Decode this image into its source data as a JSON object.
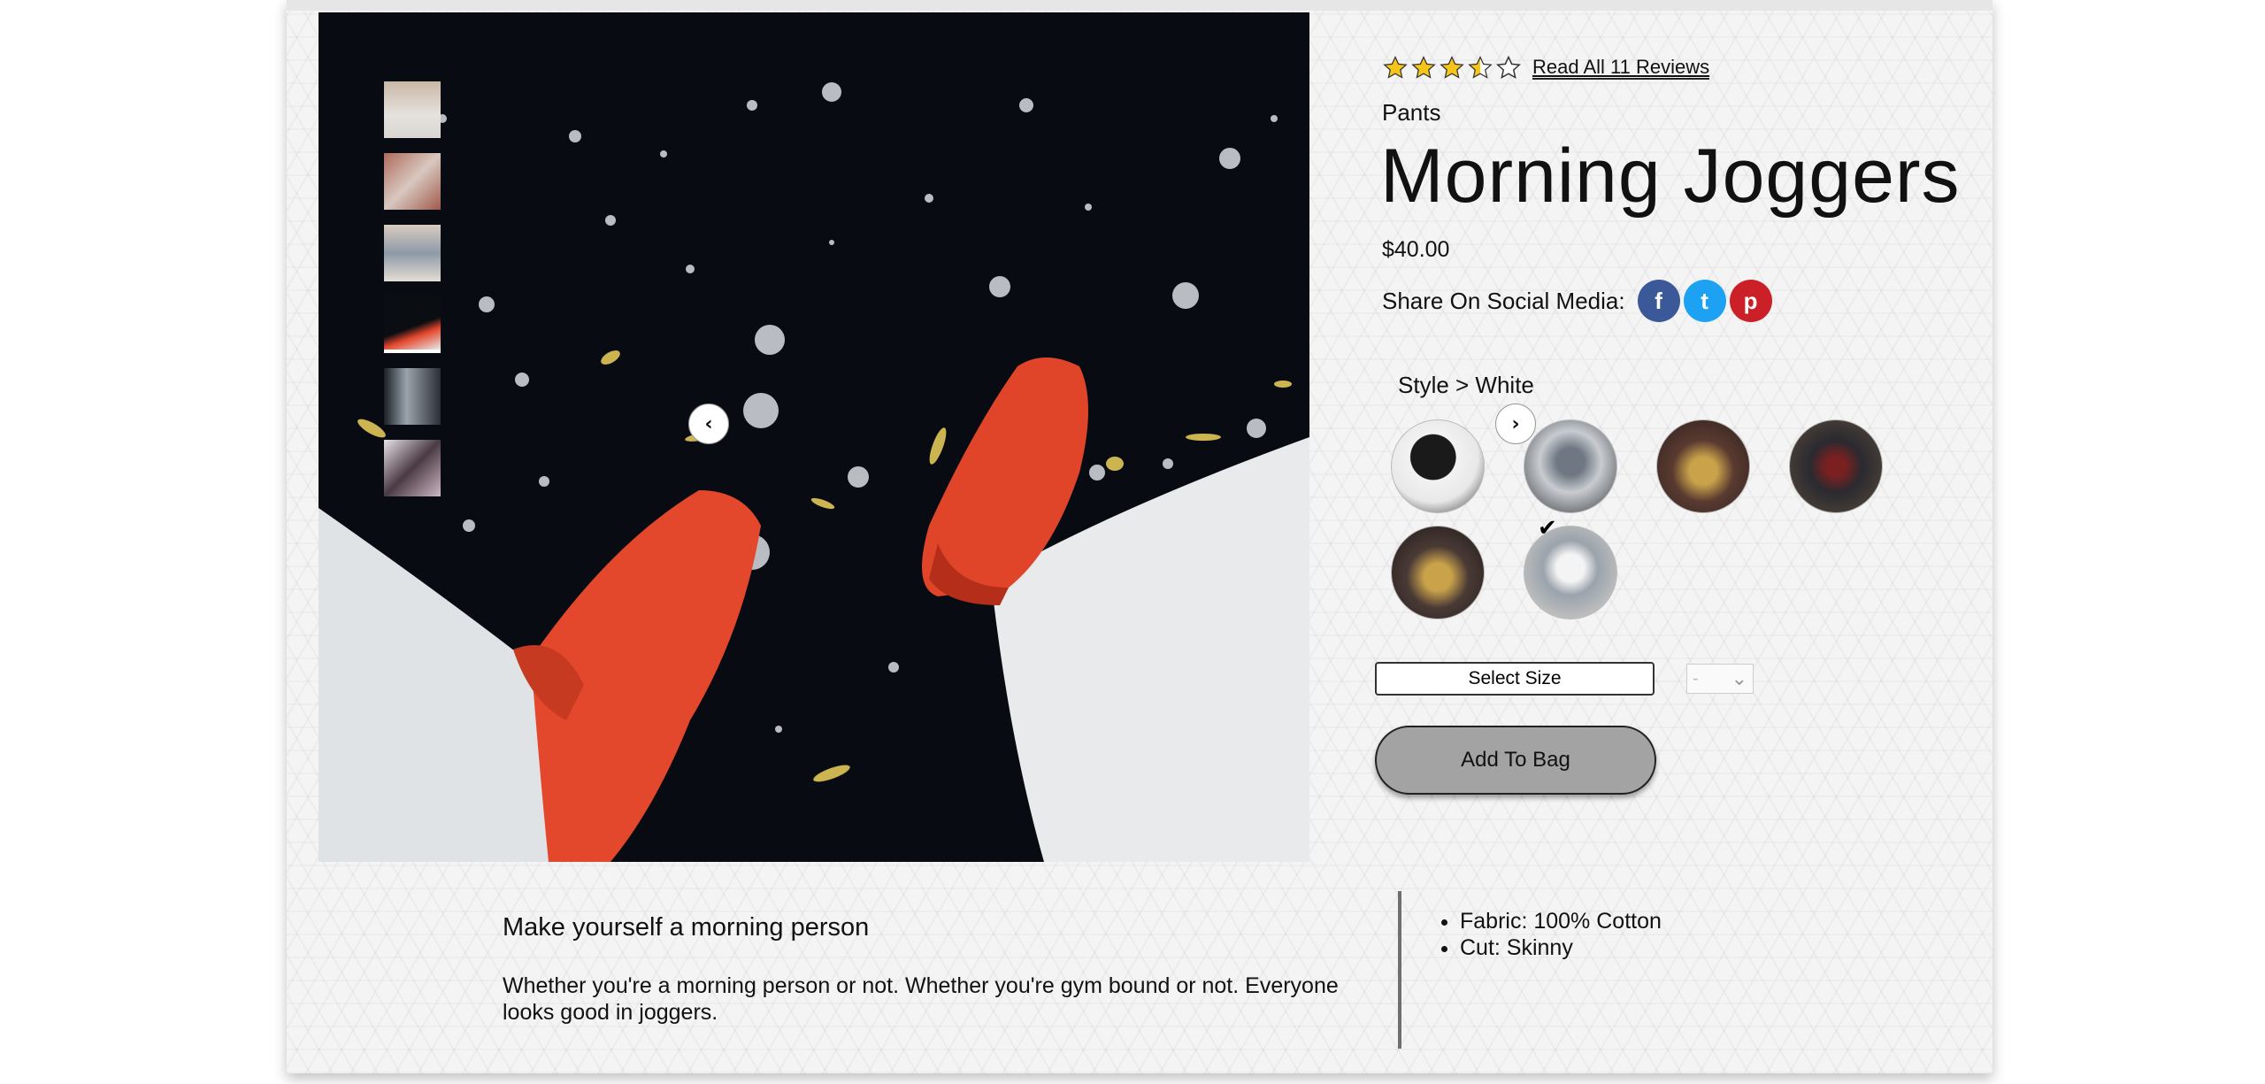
{
  "product": {
    "rating": 3.5,
    "rating_max": 5,
    "reviews_link": "Read All 11 Reviews",
    "category": "Pants",
    "title": "Morning Joggers",
    "price": "$40.00"
  },
  "share": {
    "label": "Share On Social Media:",
    "networks": [
      {
        "name": "facebook-icon",
        "glyph": "f",
        "color": "#3b5998"
      },
      {
        "name": "twitter-icon",
        "glyph": "t",
        "color": "#1da1f2"
      },
      {
        "name": "pinterest-icon",
        "glyph": "p",
        "color": "#cb2027"
      }
    ]
  },
  "style": {
    "label": "Style > White",
    "selected_index": 5,
    "swatch_count": 6,
    "check_glyph": "✔"
  },
  "gallery": {
    "thumbnail_count": 6,
    "active_thumbnail": 3,
    "prev_glyph": "‹",
    "next_glyph": "›"
  },
  "controls": {
    "size_label": "Select Size",
    "quantity_value": "-",
    "quantity_caret": "⌄",
    "add_to_bag_label": "Add To Bag"
  },
  "description": {
    "heading": "Make yourself a morning person",
    "body": "Whether you're a morning person or not. Whether you're gym bound or not. Everyone looks good in joggers."
  },
  "features": [
    "Fabric: 100% Cotton",
    "Cut: Skinny"
  ],
  "colors": {
    "star_fill": "#f5c518",
    "button_gray": "#a3a3a3",
    "facebook": "#3b5998",
    "twitter": "#1da1f2",
    "pinterest": "#cb2027"
  }
}
